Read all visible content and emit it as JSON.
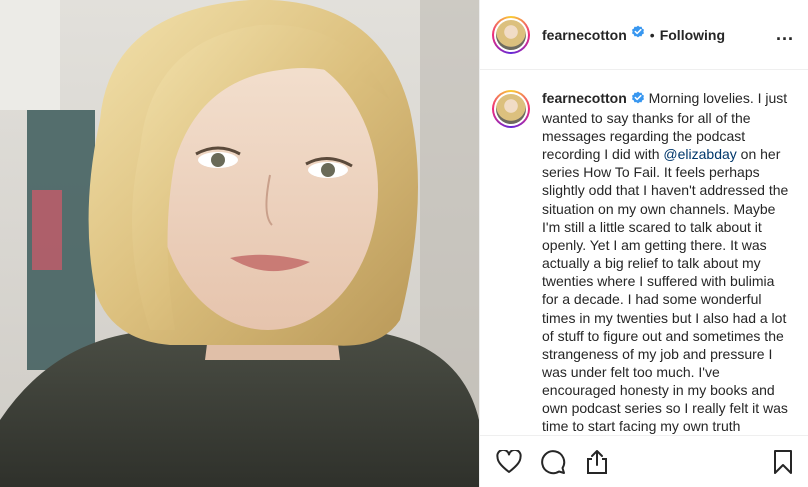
{
  "header": {
    "username": "fearnecotton",
    "separator": "•",
    "follow_status": "Following",
    "more_label": "..."
  },
  "caption": {
    "username": "fearnecotton",
    "text_before_mention": " Morning lovelies. I just wanted to say thanks for all of the messages regarding the podcast recording I did with ",
    "mention": "@elizabday",
    "text_after_mention": " on her series How To Fail. It feels perhaps slightly odd that I haven't addressed the situation on my own channels. Maybe I'm still a little scared to talk about it openly. Yet I am getting there. It was actually a big relief to talk about my twenties where I suffered with bulimia for a decade. I had some wonderful times in my twenties but I also had a lot of stuff to figure out and sometimes the strangeness of my job and pressure I was under felt too much. I've encouraged honesty in my books and own podcast series so I really felt it was time to start facing my own truth"
  },
  "icons": {
    "verified": "verified-badge-icon",
    "like": "heart-icon",
    "comment": "comment-icon",
    "share": "share-icon",
    "save": "bookmark-icon"
  },
  "colors": {
    "verified": "#3897f0",
    "mention": "#00376b",
    "text": "#262626",
    "border": "#efefef"
  }
}
